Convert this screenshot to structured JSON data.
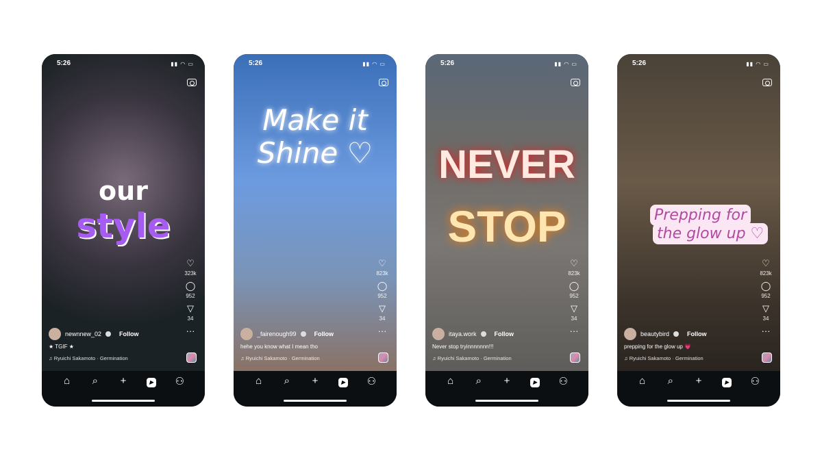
{
  "status_time": "5:26",
  "nav_icons": [
    "home-icon",
    "search-icon",
    "create-icon",
    "reels-icon",
    "profile-icon"
  ],
  "phones": [
    {
      "overlay": [
        "our",
        "style"
      ],
      "username": "newnnew_02",
      "follow": "Follow",
      "caption": "★ TGIF ★",
      "music": "♫ Ryuichi Sakamoto · Germination",
      "likes": "323k",
      "comments": "952",
      "shares": "34"
    },
    {
      "overlay": [
        "Make it",
        "Shine ♡"
      ],
      "username": "_fairenough99",
      "follow": "Follow",
      "caption": "hehe you know what I mean tho",
      "music": "♫ Ryuichi Sakamoto · Germination",
      "likes": "823k",
      "comments": "952",
      "shares": "34"
    },
    {
      "overlay": [
        "NEVER",
        "STOP"
      ],
      "username": "itaya.work",
      "follow": "Follow",
      "caption": "Never stop tryinnnnnnn!!!",
      "music": "♫ Ryuichi Sakamoto · Germination",
      "likes": "823k",
      "comments": "952",
      "shares": "34"
    },
    {
      "overlay": [
        "Prepping for",
        "the glow up ♡"
      ],
      "username": "beautybird",
      "follow": "Follow",
      "caption": "prepping for the glow up 💗",
      "music": "♫ Ryuichi Sakamoto · Germination",
      "likes": "823k",
      "comments": "952",
      "shares": "34"
    }
  ]
}
